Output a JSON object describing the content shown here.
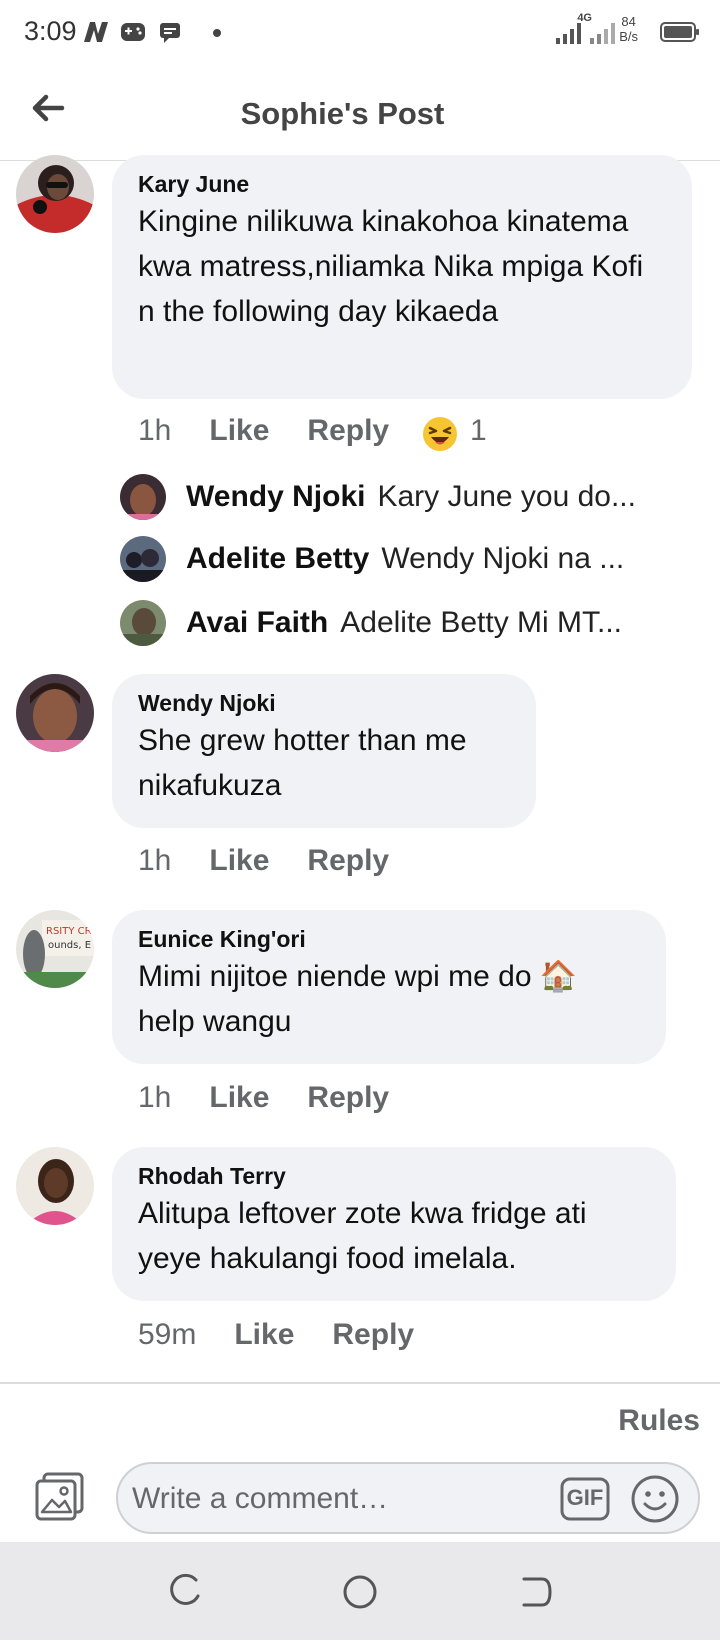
{
  "status_bar": {
    "time": "3:09",
    "network": "4G",
    "speed_value": "84",
    "speed_unit": "B/s"
  },
  "header": {
    "title": "Sophie's Post"
  },
  "comments": [
    {
      "author": "Kary June",
      "text": "Kingine nilikuwa kinakohoa kinatema kwa matress,niliamka Nika mpiga Kofi n the following day kikaeda",
      "time": "1h",
      "like": "Like",
      "reply": "Reply",
      "reaction_count": "1",
      "replies": [
        {
          "author": "Wendy Njoki",
          "preview": "Kary June you do..."
        },
        {
          "author": "Adelite Betty",
          "preview": "Wendy Njoki na ..."
        },
        {
          "author": "Avai Faith",
          "preview": "Adelite Betty Mi MT..."
        }
      ]
    },
    {
      "author": "Wendy Njoki",
      "text": "She grew hotter than me nikafukuza",
      "time": "1h",
      "like": "Like",
      "reply": "Reply"
    },
    {
      "author": "Eunice King'ori",
      "text": "Mimi nijitoe niende wpi me do 🏠 help wangu",
      "time": "1h",
      "like": "Like",
      "reply": "Reply"
    },
    {
      "author": "Rhodah Terry",
      "text": "Alitupa leftover zote kwa fridge ati yeye hakulangi food imelala.",
      "time": "59m",
      "like": "Like",
      "reply": "Reply"
    }
  ],
  "footer": {
    "rules_label": "Rules",
    "comment_placeholder": "Write a comment…",
    "gif_label": "GIF"
  },
  "icons": {
    "back": "arrow-left-icon",
    "photo": "photo-icon",
    "gif": "gif-icon",
    "emoji": "smiley-icon",
    "haha": "laughing-emoji-icon"
  },
  "colors": {
    "bubble": "#f0f2f5",
    "secondary_text": "#65676b",
    "nav_bg": "#e9e9eb"
  }
}
